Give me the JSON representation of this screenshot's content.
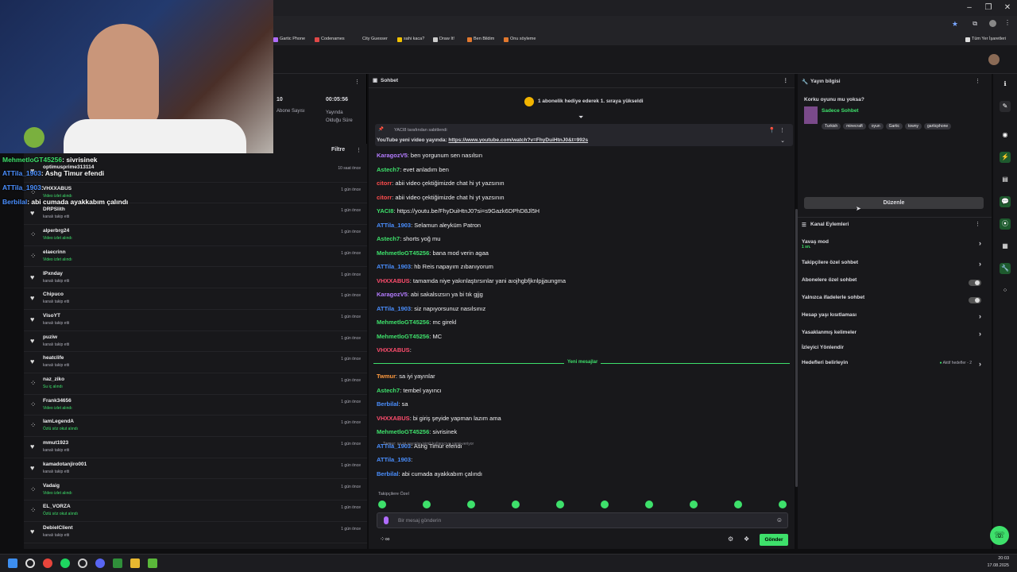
{
  "browser": {
    "bookmarks": [
      "Gartic Phone",
      "Codenames",
      "City Guesser",
      "sahi kaca?",
      "Draw It!",
      "Ben Bildim",
      "Onu söyleme"
    ],
    "all_bookmarks": "Tüm Yer İşaretleri"
  },
  "stats": {
    "subs_value": "10",
    "subs_label": "Abone Sayısı",
    "time_value": "00:05:56",
    "time_label": "Yayında Olduğu Süre"
  },
  "activity": {
    "filter_label": "Filtre",
    "items": [
      {
        "name": "optimusprime313114",
        "sub": "",
        "tm": "10 saat önce",
        "icon": "heart"
      },
      {
        "name": "VHXXABUS",
        "sub": "Video izlet alındı",
        "tm": "1 gün önce",
        "icon": "gift"
      },
      {
        "name": "DRPSlith",
        "sub": "kanalı takip etti",
        "tm": "1 gün önce",
        "icon": "heart"
      },
      {
        "name": "alperbrg24",
        "sub": "Video izlet alındı",
        "tm": "1 gün önce",
        "icon": "gift"
      },
      {
        "name": "elaecrinn",
        "sub": "Video izlet alındı",
        "tm": "1 gün önce",
        "icon": "gift"
      },
      {
        "name": "lPxnday",
        "sub": "kanalı takip etti",
        "tm": "1 gün önce",
        "icon": "heart"
      },
      {
        "name": "Chipuco",
        "sub": "kanalı takip etti",
        "tm": "1 gün önce",
        "icon": "heart"
      },
      {
        "name": "VisoYT",
        "sub": "kanalı takip etti",
        "tm": "1 gün önce",
        "icon": "heart"
      },
      {
        "name": "puziw",
        "sub": "kanalı takip etti",
        "tm": "1 gün önce",
        "icon": "heart"
      },
      {
        "name": "heatclife",
        "sub": "kanalı takip etti",
        "tm": "1 gün önce",
        "icon": "heart"
      },
      {
        "name": "naz_ziko",
        "sub": "Su iç alındı",
        "tm": "1 gün önce",
        "icon": "gift"
      },
      {
        "name": "Frank34656",
        "sub": "Video izlet alındı",
        "tm": "1 gün önce",
        "icon": "gift"
      },
      {
        "name": "IamLegendA",
        "sub": "Özlü söz okut alındı",
        "tm": "1 gün önce",
        "icon": "gift"
      },
      {
        "name": "mmut1923",
        "sub": "kanalı takip etti",
        "tm": "1 gün önce",
        "icon": "heart"
      },
      {
        "name": "kamadotanjiro001",
        "sub": "kanalı takip etti",
        "tm": "1 gün önce",
        "icon": "heart"
      },
      {
        "name": "Vadaig",
        "sub": "Video izlet alındı",
        "tm": "1 gün önce",
        "icon": "gift"
      },
      {
        "name": "EL_VORZA",
        "sub": "Özlü söz okut alındı",
        "tm": "1 gün önce",
        "icon": "gift"
      },
      {
        "name": "DebielClient",
        "sub": "kanalı takip etti",
        "tm": "1 gün önce",
        "icon": "heart"
      }
    ]
  },
  "overlay": [
    {
      "user": "MehmetloGT45256",
      "text": ": sivrisinek",
      "color": "#3ee06b"
    },
    {
      "user": "ATTila_1903",
      "text": ": Ashg Timur efendi",
      "color": "#4a8fff"
    },
    {
      "user": "ATTila_1903",
      "text": ":",
      "color": "#4a8fff"
    },
    {
      "user": "Berbilal",
      "text": ": abi cumada ayakkabım çalındı",
      "color": "#4a8fff"
    }
  ],
  "chat": {
    "title": "Sohbet",
    "gift_banner": "1 abonelik hediye ederek 1. sıraya yükseldi",
    "pinned_by": "YACI8 tarafından sabitlendi",
    "pinned_text": "YouTube yeni video yayında: ",
    "pinned_link": "https://www.youtube.com/watch?v=FhyDuiHtnJ0&t=992s",
    "messages": [
      {
        "user": "KaragozV5",
        "text": ": ben yorgunum sen nasılsın",
        "color": "#b47cff"
      },
      {
        "user": "Astech7",
        "text": ": evet anladım ben",
        "color": "#3ee06b"
      },
      {
        "user": "citorr",
        "text": ": abii video çektiğimizde chat hi yt yazsının",
        "color": "#ff4d4d"
      },
      {
        "user": "citorr",
        "text": ": abii video çektiğimizde chat hi yt yazsının",
        "color": "#ff4d4d"
      },
      {
        "user": "YACI8",
        "text": ": https://youtu.be/FhyDuiHtnJ0?si=s9Gazk6DPhD8Jl5H",
        "color": "#3ee06b"
      },
      {
        "user": "ATTila_1903",
        "text": ": Selamun aleyküm Patron",
        "color": "#4a8fff"
      },
      {
        "user": "Astech7",
        "text": ": shorts yoğ mu",
        "color": "#3ee06b"
      },
      {
        "user": "MehmetloGT45256",
        "text": ": bana mod verin agaa",
        "color": "#3ee06b"
      },
      {
        "user": "ATTila_1903",
        "text": ": hb Reis napayım zıbanıyorum",
        "color": "#4a8fff"
      },
      {
        "user": "VHXXABUS",
        "text": ": tamamda niye yakınlaştırsınlar yani aıojhgbfjknlpjjaungma",
        "color": "#ff4d6d"
      },
      {
        "user": "KaragozV5",
        "text": ": abi sakalsızsın ya bi tık gjjg",
        "color": "#b47cff"
      },
      {
        "user": "ATTila_1903",
        "text": ": siz napıyorsunuz nasılsınız",
        "color": "#4a8fff"
      },
      {
        "user": "MehmetloGT45256",
        "text": ": mc girekl",
        "color": "#3ee06b"
      },
      {
        "user": "MehmetloGT45256",
        "text": ": MC",
        "color": "#3ee06b"
      },
      {
        "user": "VHXXABUS",
        "text": ":",
        "color": "#ff4d6d"
      }
    ],
    "new_messages_label": "Yeni mesajlar",
    "new_messages": [
      {
        "user": "Twmur",
        "text": ": sa iyi yayınlar",
        "color": "#ff9a3e"
      },
      {
        "user": "Astech7",
        "text": ": tembel yayıncı",
        "color": "#3ee06b"
      },
      {
        "user": "Berbilal",
        "text": ": sa",
        "color": "#4a8fff"
      },
      {
        "user": "VHXXABUS",
        "text": ": bi giriş şeyide yapman lazım ama",
        "color": "#ff4d6d"
      },
      {
        "user": "MehmetloGT45256",
        "text": ": sivrisinek",
        "color": "#3ee06b"
      },
      {
        "user": "ATTila_1903",
        "text": ": Ashg Timur efendi",
        "color": "#4a8fff"
      },
      {
        "user": "ATTila_1903",
        "text": ":",
        "color": "#4a8fff"
      },
      {
        "user": "Berbilal",
        "text": ": abi cumada ayakkabım çalındı",
        "color": "#4a8fff"
      }
    ],
    "reply_note": "Twmur: sa iyi yayınlar isimli kullanıcıya yanıt veriyor",
    "followers_only": "Takipçilere Özel",
    "placeholder": "Bir mesaj gönderin",
    "send_label": "Gönder"
  },
  "streaminfo": {
    "header": "Yayın bilgisi",
    "title": "Korku oyunu mu yoksa?",
    "category": "Sadece Sohbet",
    "tags": [
      "Turkish",
      "minecraft",
      "oyun",
      "Gartic",
      "towny",
      "garticphone"
    ],
    "edit_label": "Düzenle"
  },
  "channel_actions": {
    "header": "Kanal Eylemleri",
    "slow_mode": "Yavaş mod",
    "slow_value": "1 sn.",
    "followers_chat": "Takipçilere özel sohbet",
    "subs_chat": "Abonelere özel sohbet",
    "emote_chat": "Yalnızca ifadelerle sohbet",
    "age_restrict": "Hesap yaşı kısıtlaması",
    "banned_words": "Yasaklanmış kelimeler",
    "redirect": "İzleyici Yönlendir",
    "goals": "Hedefleri belirleyin",
    "goals_status": "Aktif hedefler - 2"
  },
  "taskbar": {
    "time": "20:03",
    "date": "17.08.2025"
  },
  "colors": {
    "accent": "#3ee06b",
    "bg": "#18181b"
  }
}
